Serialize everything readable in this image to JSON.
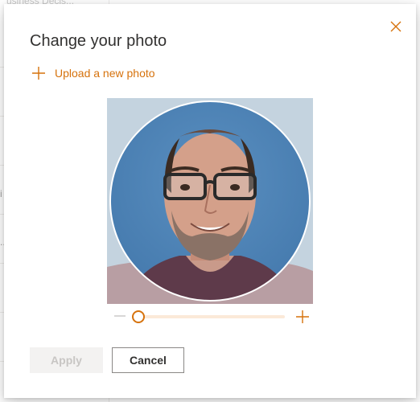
{
  "background": {
    "snippet": "usiness Decis...",
    "row_chars": [
      "i",
      "..."
    ]
  },
  "dialog": {
    "title": "Change your photo",
    "upload_label": "Upload a new photo",
    "close_icon": "close-icon",
    "photo": {
      "icon": "profile-photo"
    },
    "zoom": {
      "level": 0.0,
      "min_icon": "zoom-out-icon",
      "max_icon": "zoom-in-icon"
    },
    "apply_label": "Apply",
    "cancel_label": "Cancel"
  },
  "colors": {
    "accent": "#d6720c",
    "track": "#fbe9d8",
    "text": "#323130",
    "disabled_bg": "#f3f2f1",
    "disabled_text": "#c8c6c4"
  }
}
